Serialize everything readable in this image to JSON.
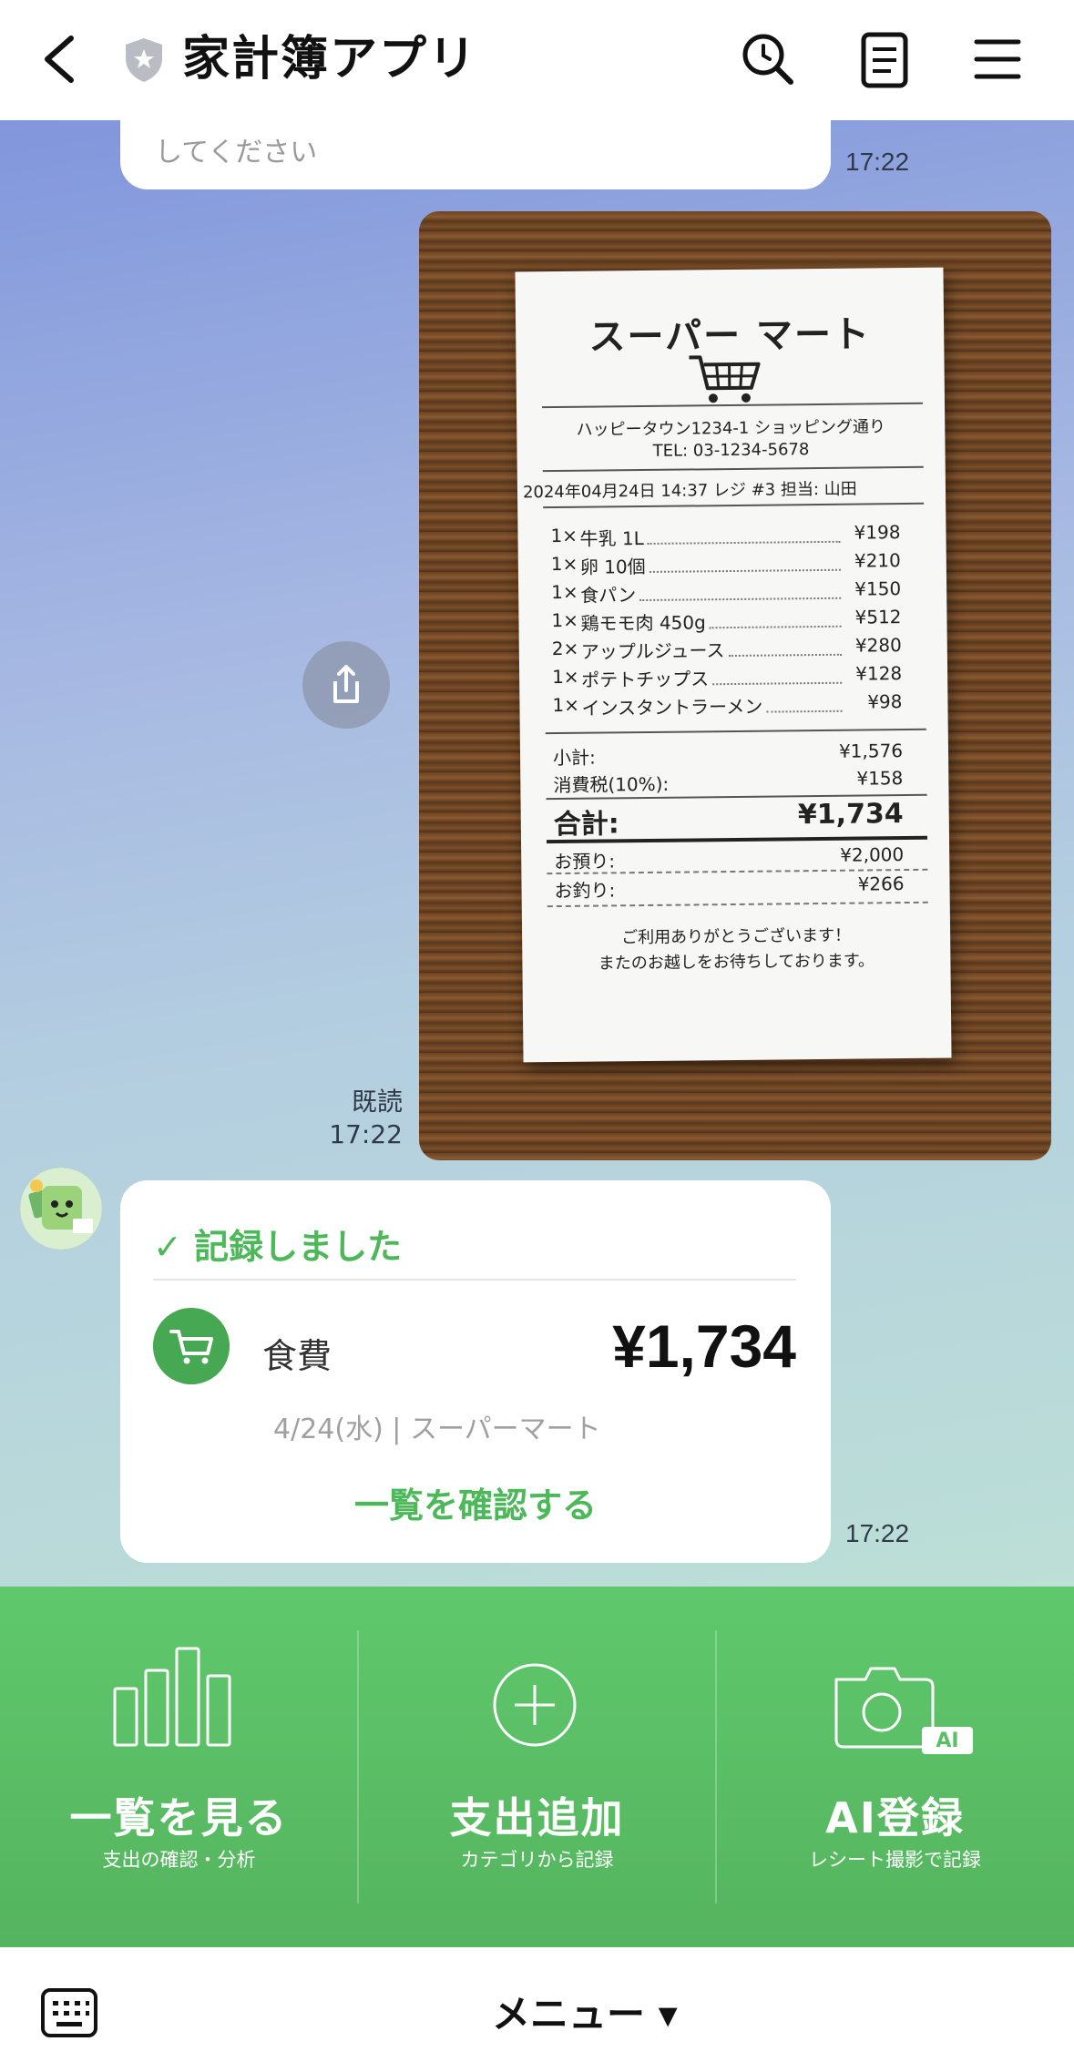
{
  "header": {
    "title": "家計簿アプリ"
  },
  "chat": {
    "prev_bubble_text": "してください",
    "prev_time": "17:22",
    "receipt": {
      "store": "スーパー マート",
      "address": "ハッピータウン1234-1 ショッピング通り",
      "tel": "TEL: 03-1234-5678",
      "meta": "2024年04月24日 14:37  レジ #3   担当: 山田",
      "items": [
        {
          "qty": "1×",
          "name": "牛乳 1L",
          "price": "¥198"
        },
        {
          "qty": "1×",
          "name": "卵 10個",
          "price": "¥210"
        },
        {
          "qty": "1×",
          "name": "食パン",
          "price": "¥150"
        },
        {
          "qty": "1×",
          "name": "鶏モモ肉 450g",
          "price": "¥512"
        },
        {
          "qty": "2×",
          "name": "アップルジュース",
          "price": "¥280"
        },
        {
          "qty": "1×",
          "name": "ポテトチップス",
          "price": "¥128"
        },
        {
          "qty": "1×",
          "name": "インスタントラーメン",
          "price": "¥98"
        }
      ],
      "subtotal_label": "小計:",
      "subtotal": "¥1,576",
      "tax_label": "消費税(10%):",
      "tax": "¥158",
      "total_label": "合計:",
      "total": "¥1,734",
      "paid_label": "お預り:",
      "paid": "¥2,000",
      "change_label": "お釣り:",
      "change": "¥266",
      "thanks1": "ご利用ありがとうございます！",
      "thanks2": "またのお越しをお待ちしております。"
    },
    "read_label": "既読",
    "read_time": "17:22",
    "record": {
      "status": "✓ 記録しました",
      "category": "食費",
      "amount": "¥1,734",
      "sub": "4/24(水) | スーパーマート",
      "link": "一覧を確認する",
      "time": "17:22"
    }
  },
  "richmenu": [
    {
      "title": "一覧を見る",
      "sub": "支出の確認・分析"
    },
    {
      "title": "支出追加",
      "sub": "カテゴリから記録"
    },
    {
      "title": "AI登録",
      "sub": "レシート撮影で記録",
      "badge": "AI"
    }
  ],
  "bottombar": {
    "menu_label": "メニュー ▾"
  },
  "colors": {
    "accent_green": "#4cb85a",
    "menu_green": "#5bbf66"
  }
}
